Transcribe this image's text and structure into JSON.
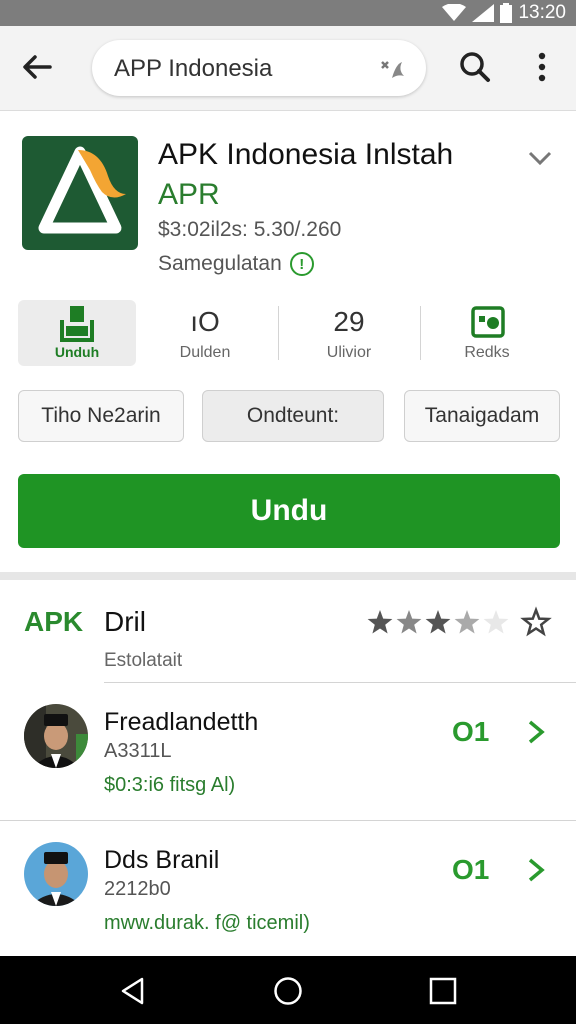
{
  "status_bar": {
    "time": "13:20"
  },
  "search": {
    "query": "APP Indonesia"
  },
  "app": {
    "title": "APK Indonesia Inlstah",
    "developer": "APR",
    "meta_line": "$3:02il2s: 5.30/.260",
    "category": "Samegulatan",
    "info_symbol": "!"
  },
  "stats": [
    {
      "value": "",
      "label": "Unduh",
      "icon": "download-icon"
    },
    {
      "value": "ıO",
      "label": "Dulden"
    },
    {
      "value": "29",
      "label": "Ulivior"
    },
    {
      "value": "",
      "label": "Redks",
      "icon": "photo-icon"
    }
  ],
  "chips": [
    "Tiho Ne2arin",
    "Ondteunt:",
    "Tanaigadam"
  ],
  "install_label": "Undu",
  "section": {
    "tag": "APK",
    "title": "Dril",
    "subtitle": "Estolatait",
    "rating": 3.5,
    "max_rating": 5
  },
  "reviews": [
    {
      "name": "Freadlandetth",
      "id": "A3311L",
      "link": "$0:3:i6 fitsg Al)",
      "count": "O1"
    },
    {
      "name": "Dds Branil",
      "id": "2212b0",
      "link": "mww.durak. f@ ticemil)",
      "count": "O1"
    }
  ],
  "colors": {
    "brand_green": "#1f9424",
    "text_green": "#2a7d2e",
    "logo_bg": "#1e5a33",
    "logo_accent": "#f3a533"
  }
}
